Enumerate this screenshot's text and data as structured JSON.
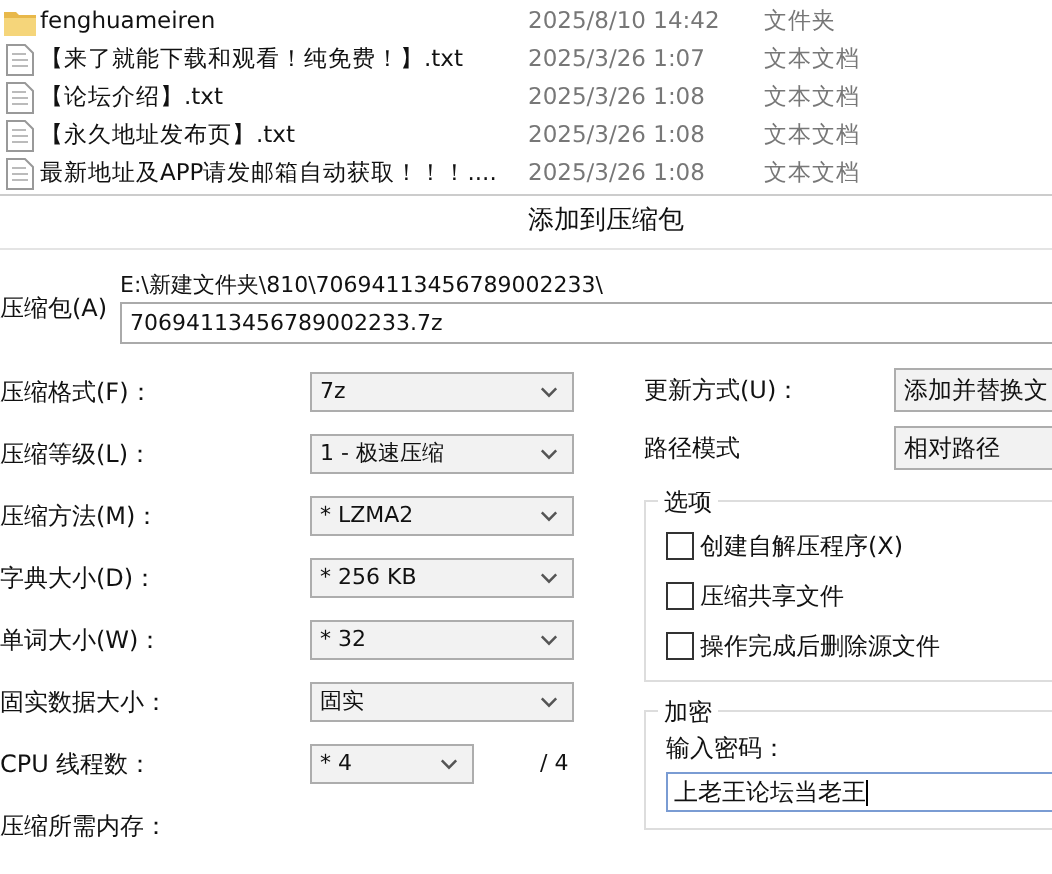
{
  "files": [
    {
      "kind": "folder",
      "name": "fenghuameiren",
      "date": "2025/8/10 14:42",
      "type": "文件夹"
    },
    {
      "kind": "text",
      "name": "【来了就能下载和观看！纯免费！】.txt",
      "date": "2025/3/26 1:07",
      "type": "文本文档"
    },
    {
      "kind": "text",
      "name": "【论坛介绍】.txt",
      "date": "2025/3/26 1:08",
      "type": "文本文档"
    },
    {
      "kind": "text",
      "name": "【永久地址发布页】.txt",
      "date": "2025/3/26 1:08",
      "type": "文本文档"
    },
    {
      "kind": "text",
      "name": "最新地址及APP请发邮箱自动获取！！！....",
      "date": "2025/3/26 1:08",
      "type": "文本文档"
    }
  ],
  "dialog": {
    "title": "添加到压缩包",
    "archive": {
      "label": "压缩包(A)",
      "path": "E:\\新建文件夹\\810\\70694113456789002233\\",
      "value": "70694113456789002233.7z"
    },
    "settings": [
      {
        "label": "压缩格式(F)：",
        "value": "7z"
      },
      {
        "label": "压缩等级(L)：",
        "value": "1 - 极速压缩"
      },
      {
        "label": "压缩方法(M)：",
        "value": "* LZMA2"
      },
      {
        "label": "字典大小(D)：",
        "value": "* 256 KB"
      },
      {
        "label": "单词大小(W)：",
        "value": "* 32"
      },
      {
        "label": "固实数据大小：",
        "value": "固实"
      },
      {
        "label": "CPU 线程数：",
        "value": "* 4",
        "suffix": "/ 4"
      },
      {
        "label": "压缩所需内存："
      }
    ],
    "update_mode": {
      "label": "更新方式(U)：",
      "value": "添加并替换文"
    },
    "path_mode": {
      "label": "路径模式",
      "value": "相对路径"
    },
    "options": {
      "title": "选项",
      "items": [
        {
          "label": "创建自解压程序(X)",
          "checked": false
        },
        {
          "label": "压缩共享文件",
          "checked": false
        },
        {
          "label": "操作完成后删除源文件",
          "checked": false
        }
      ]
    },
    "encryption": {
      "title": "加密",
      "password_label": "输入密码：",
      "password": "上老王论坛当老王"
    }
  }
}
